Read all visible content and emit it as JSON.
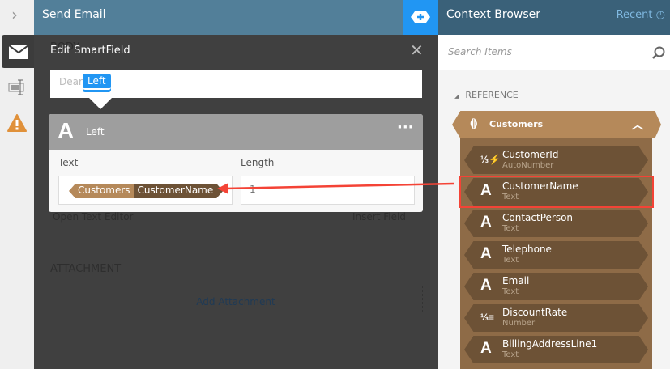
{
  "rail": {
    "items": [
      "expand",
      "email",
      "text-field",
      "warning"
    ]
  },
  "header": {
    "title": "Send Email"
  },
  "main": {
    "body_label": "BODY",
    "open_text_editor": "Open Text Editor",
    "insert_field": "Insert Field",
    "attachment_label": "ATTACHMENT",
    "add_attachment": "Add Attachment"
  },
  "modal": {
    "title": "Edit SmartField",
    "preview_text": "Dear",
    "preview_token": "Left",
    "function_name": "Left",
    "text_label": "Text",
    "length_label": "Length",
    "length_value": "1",
    "token_entity": "Customers",
    "token_field": "CustomerName"
  },
  "context_browser": {
    "title": "Context Browser",
    "recent": "Recent",
    "search_placeholder": "Search Items",
    "section": "REFERENCE",
    "group": "Customers",
    "items": [
      {
        "name": "CustomerId",
        "type": "AutoNumber",
        "icon": "autonumber"
      },
      {
        "name": "CustomerName",
        "type": "Text",
        "icon": "A"
      },
      {
        "name": "ContactPerson",
        "type": "Text",
        "icon": "A"
      },
      {
        "name": "Telephone",
        "type": "Text",
        "icon": "A"
      },
      {
        "name": "Email",
        "type": "Text",
        "icon": "A"
      },
      {
        "name": "DiscountRate",
        "type": "Number",
        "icon": "number"
      },
      {
        "name": "BillingAddressLine1",
        "type": "Text",
        "icon": "A"
      }
    ]
  },
  "colors": {
    "accent": "#2196f3",
    "highlight": "#f44336",
    "entity": "#b5895a",
    "field": "#6d5236"
  }
}
